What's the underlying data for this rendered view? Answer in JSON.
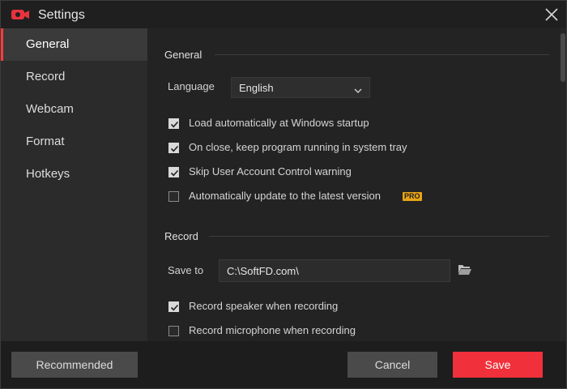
{
  "window": {
    "title": "Settings",
    "accent_color": "#ff3b3b"
  },
  "sidebar": {
    "items": [
      {
        "label": "General",
        "active": true
      },
      {
        "label": "Record",
        "active": false
      },
      {
        "label": "Webcam",
        "active": false
      },
      {
        "label": "Format",
        "active": false
      },
      {
        "label": "Hotkeys",
        "active": false
      }
    ]
  },
  "general": {
    "title": "General",
    "language_label": "Language",
    "language_value": "English",
    "checkboxes": [
      {
        "label": "Load automatically at Windows startup",
        "checked": true
      },
      {
        "label": "On close, keep program running in system tray",
        "checked": true
      },
      {
        "label": "Skip User Account Control warning",
        "checked": true
      },
      {
        "label": "Automatically update to the latest version",
        "checked": false,
        "badge": "PRO"
      }
    ]
  },
  "record": {
    "title": "Record",
    "save_to_label": "Save to",
    "save_to_value": "C:\\SoftFD.com\\",
    "checkboxes": [
      {
        "label": "Record speaker when recording",
        "checked": true
      },
      {
        "label": "Record microphone when recording",
        "checked": false
      }
    ]
  },
  "footer": {
    "recommended_label": "Recommended",
    "cancel_label": "Cancel",
    "save_label": "Save"
  }
}
